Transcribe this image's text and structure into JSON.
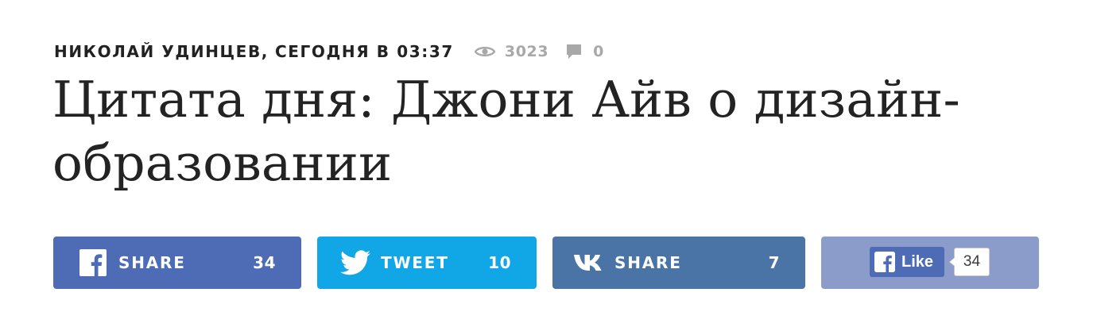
{
  "meta": {
    "author": "НИКОЛАЙ УДИНЦЕВ",
    "date": "СЕГОДНЯ В 03:37",
    "views": "3023",
    "comments": "0"
  },
  "article": {
    "title": "Цитата дня: Джони Айв о дизайн-образовании"
  },
  "share": {
    "facebook": {
      "label": "SHARE",
      "count": "34",
      "icon": "facebook-icon",
      "color": "#4d6cb5"
    },
    "twitter": {
      "label": "TWEET",
      "count": "10",
      "icon": "twitter-icon",
      "color": "#11a7e7"
    },
    "vk": {
      "label": "SHARE",
      "count": "7",
      "icon": "vk-icon",
      "color": "#4a74a6"
    },
    "like": {
      "label": "Like",
      "count": "34",
      "icon": "facebook-icon",
      "color": "#8b9ccb"
    }
  }
}
